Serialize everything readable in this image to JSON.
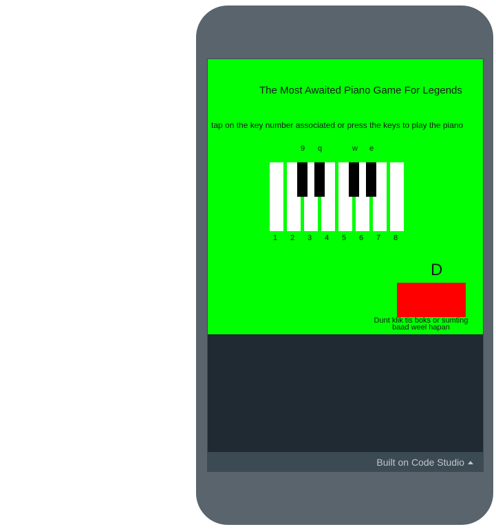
{
  "app": {
    "title": "The Most Awaited Piano Game For Legends",
    "instructions": "tap on the key number associated or press the keys to play the piano",
    "white_keys": [
      "1",
      "2",
      "3",
      "4",
      "5",
      "6",
      "7",
      "8"
    ],
    "black_keys": [
      "9",
      "q",
      "w",
      "e"
    ],
    "big_letter": "D",
    "warning_line1": "Dunt klik tis boks or sumting",
    "warning_line2": "baad weel hapan"
  },
  "footer": {
    "label": "Built on Code Studio"
  },
  "colors": {
    "app_background": "#00ff00",
    "red_box": "#ff0000",
    "phone_frame": "#59646c",
    "screen_background": "#1f2a33",
    "footer_bar": "#3c4a54"
  },
  "icons": {
    "footer_caret": "caret-up-icon"
  }
}
